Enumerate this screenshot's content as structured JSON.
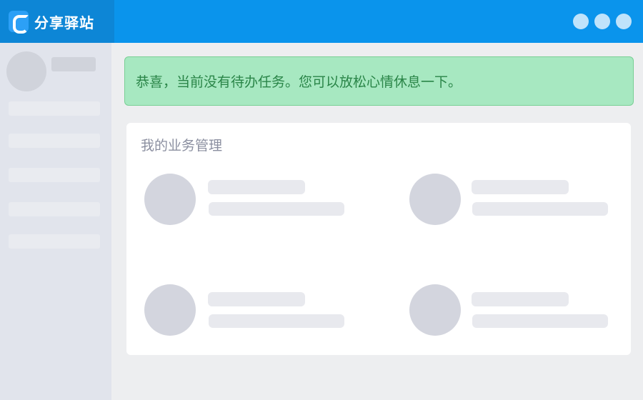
{
  "app": {
    "title": "分享驿站",
    "logo_icon": "e-logo-icon",
    "window_controls": [
      "window-dot-icon",
      "window-dot-icon",
      "window-dot-icon"
    ]
  },
  "alert": {
    "message": "恭喜，当前没有待办任务。您可以放松心情休息一下。",
    "color": "#2a8548",
    "background": "#a7e8c1"
  },
  "panel": {
    "title": "我的业务管理",
    "cards": 4
  },
  "colors": {
    "header": "#0a94ec",
    "brand_bg": "#0d86d6",
    "sidebar": "#e1e4ec"
  }
}
